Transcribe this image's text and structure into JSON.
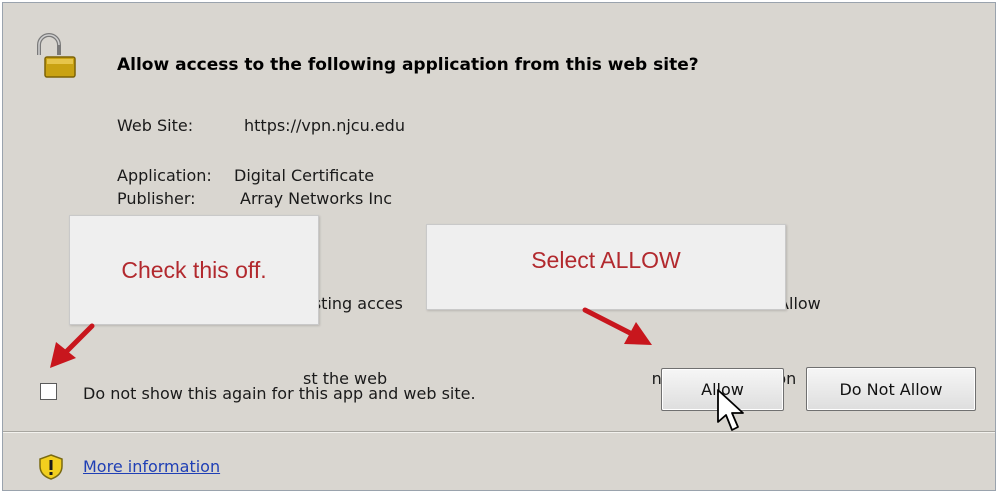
{
  "dialog": {
    "title": "Allow access to the following application from this web site?",
    "web_site_label": "Web Site:",
    "web_site_value": "https://vpn.njcu.edu",
    "application_label": "Application:",
    "application_value": "Digital Certificate",
    "publisher_label": "Publisher:",
    "publisher_value": "Array Networks Inc",
    "description_line1": "esting acces                                                   shown above. Allow",
    "description_line2": "st the web                                                    ntended to run on",
    "checkbox_label": "Do not show this again for this app and web site.",
    "checkbox_checked": false,
    "allow_button": "Allow",
    "deny_button": "Do Not Allow",
    "more_info_link": "More information"
  },
  "annotations": {
    "callout_left": "Check this off.",
    "callout_right": "Select ALLOW",
    "text_color": "#b2292e",
    "arrow_color": "#c8161d"
  },
  "icons": {
    "lock": "padlock-open-icon",
    "shield": "warning-shield-icon",
    "cursor": "mouse-pointer-icon"
  }
}
